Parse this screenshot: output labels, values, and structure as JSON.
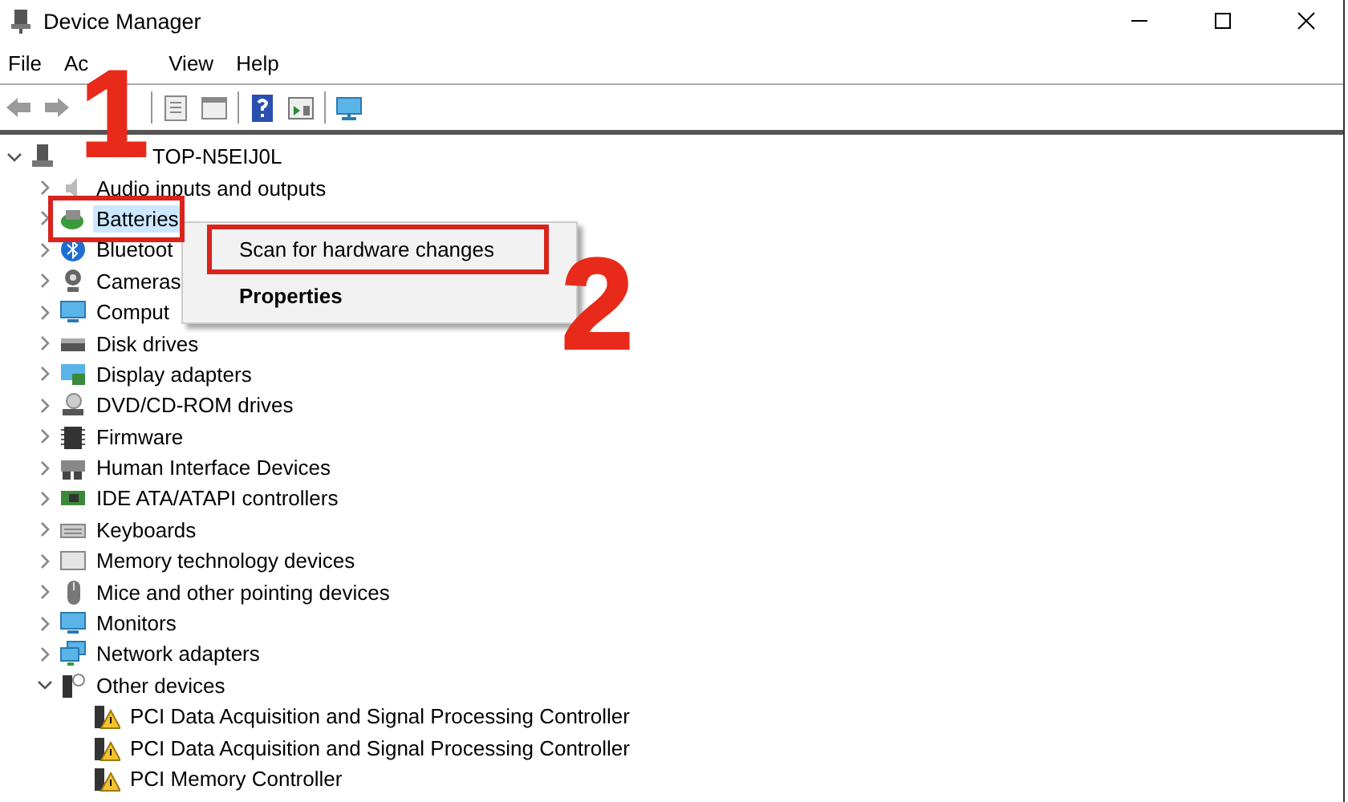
{
  "window": {
    "title": "Device Manager"
  },
  "menu": [
    "File",
    "Ac",
    "View",
    "Help"
  ],
  "tree": {
    "label": "TOP-N5EIJ0L",
    "expanded": true,
    "selected": false,
    "children": [
      {
        "label": "Audio inputs and outputs",
        "expanded": false,
        "selected": false
      },
      {
        "label": "Batteries",
        "expanded": false,
        "selected": true
      },
      {
        "label": "Bluetoot",
        "expanded": false,
        "selected": false
      },
      {
        "label": "Cameras",
        "expanded": false,
        "selected": false
      },
      {
        "label": "Comput",
        "expanded": false,
        "selected": false
      },
      {
        "label": "Disk drives",
        "expanded": false,
        "selected": false
      },
      {
        "label": "Display adapters",
        "expanded": false,
        "selected": false
      },
      {
        "label": "DVD/CD-ROM drives",
        "expanded": false,
        "selected": false
      },
      {
        "label": "Firmware",
        "expanded": false,
        "selected": false
      },
      {
        "label": "Human Interface Devices",
        "expanded": false,
        "selected": false
      },
      {
        "label": "IDE ATA/ATAPI controllers",
        "expanded": false,
        "selected": false
      },
      {
        "label": "Keyboards",
        "expanded": false,
        "selected": false
      },
      {
        "label": "Memory technology devices",
        "expanded": false,
        "selected": false
      },
      {
        "label": "Mice and other pointing devices",
        "expanded": false,
        "selected": false
      },
      {
        "label": "Monitors",
        "expanded": false,
        "selected": false
      },
      {
        "label": "Network adapters",
        "expanded": false,
        "selected": false
      },
      {
        "label": "Other devices",
        "expanded": true,
        "selected": false,
        "children": [
          {
            "label": "PCI Data Acquisition and Signal Processing Controller",
            "selected": false
          },
          {
            "label": "PCI Data Acquisition and Signal Processing Controller",
            "selected": false
          },
          {
            "label": "PCI Memory Controller",
            "selected": false
          }
        ]
      }
    ]
  },
  "context_menu": [
    {
      "label": "Scan for hardware changes",
      "kind": "normal"
    },
    {
      "label": "Properties",
      "kind": "default"
    }
  ],
  "annotations": [
    {
      "label": "1"
    },
    {
      "label": "2"
    }
  ]
}
